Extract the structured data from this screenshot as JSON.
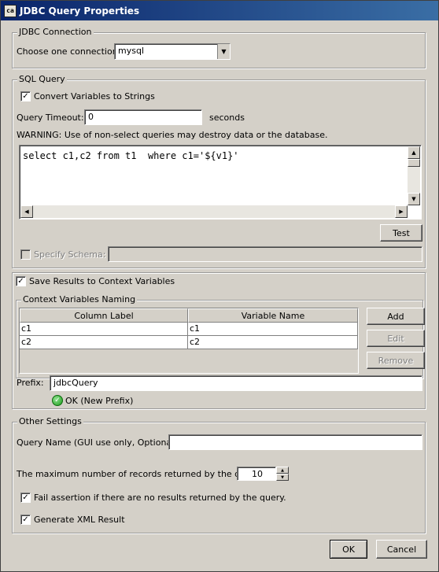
{
  "window": {
    "title": "JDBC Query Properties",
    "icon": "app-icon",
    "icon_text": "ca"
  },
  "connection": {
    "group_label": "JDBC Connection",
    "choose_label": "Choose one connection",
    "selected": "mysql"
  },
  "sql": {
    "group_label": "SQL Query",
    "convert_label": "Convert Variables to Strings",
    "convert_checked": true,
    "timeout_label": "Query Timeout:",
    "timeout_value": "0",
    "timeout_unit": "seconds",
    "warning": "WARNING: Use of non-select queries may destroy data or the database.",
    "query": "select c1,c2 from t1  where c1='${v1}'",
    "test_button": "Test",
    "schema_label": "Specify Schema:",
    "schema_value": ""
  },
  "results": {
    "save_label": "Save Results to Context Variables",
    "save_checked": true,
    "naming_group_label": "Context Variables Naming",
    "columns": [
      "Column Label",
      "Variable Name"
    ],
    "rows": [
      [
        "c1",
        "c1"
      ],
      [
        "c2",
        "c2"
      ]
    ],
    "add_button": "Add",
    "edit_button": "Edit",
    "remove_button": "Remove",
    "prefix_label": "Prefix:",
    "prefix_value": "jdbcQuery",
    "prefix_status": "OK (New Prefix)"
  },
  "other": {
    "group_label": "Other Settings",
    "query_name_label": "Query Name (GUI use only, Optional):",
    "query_name_value": "",
    "max_records_label": "The maximum number of records returned by the query:",
    "max_records_value": "10",
    "fail_label": "Fail assertion if there are no results returned by the query.",
    "fail_checked": true,
    "xml_label": "Generate XML Result",
    "xml_checked": true
  },
  "footer": {
    "ok_button": "OK",
    "cancel_button": "Cancel"
  },
  "colors": {
    "title_start": "#0a246a",
    "title_end": "#3a6ea5",
    "face": "#d4d0c8",
    "ok_green": "#1a9a1a"
  }
}
